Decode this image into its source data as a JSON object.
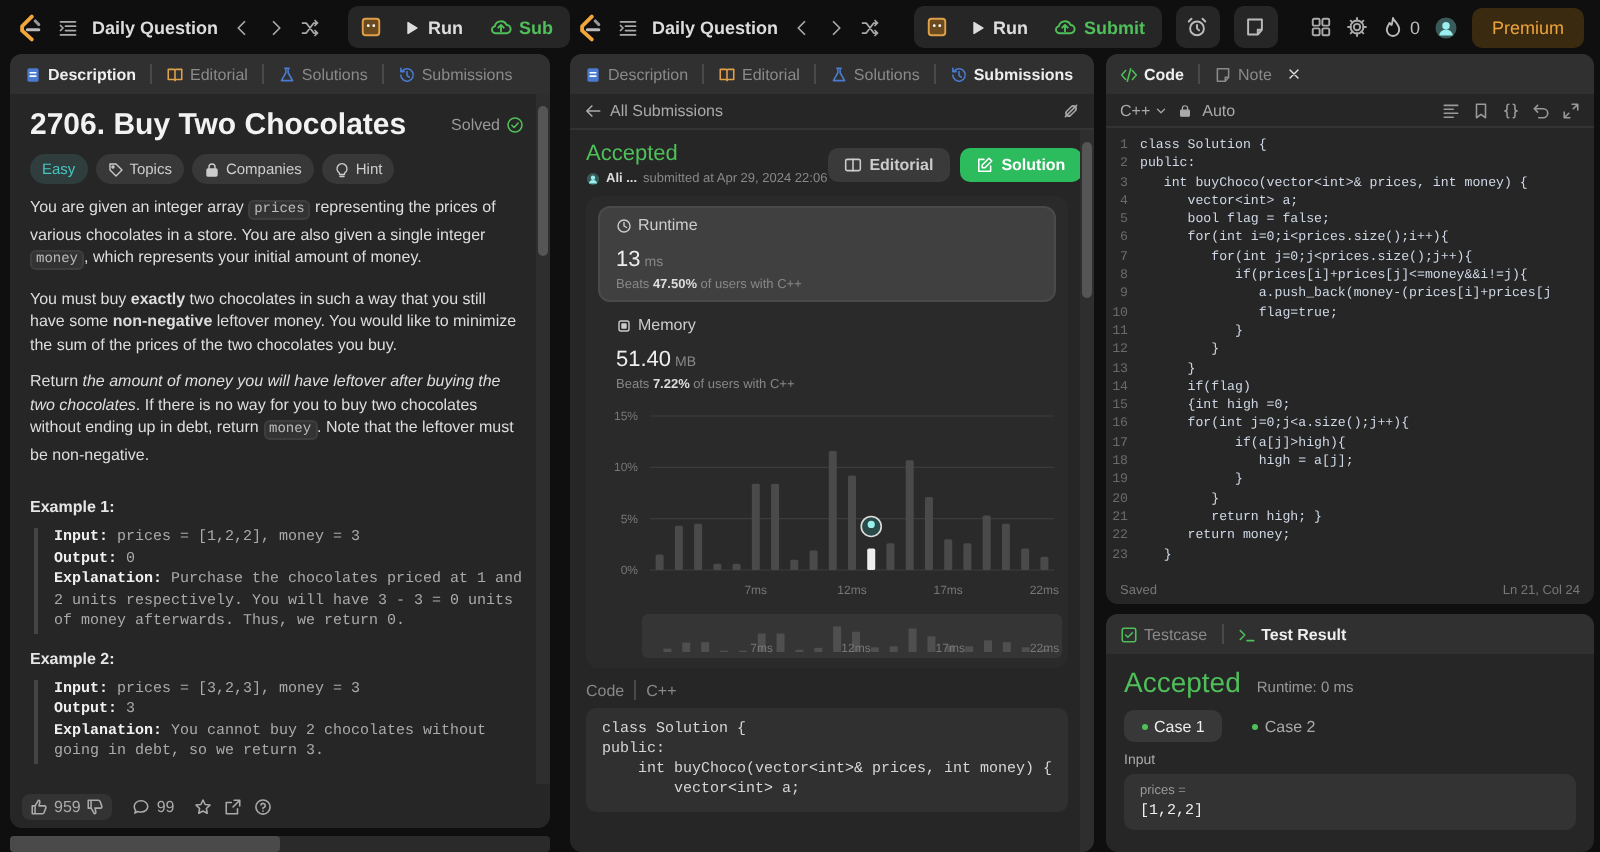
{
  "left": {
    "topbar": {
      "title": "Daily Question",
      "run": "Run",
      "submit": "Sub"
    },
    "tabs": [
      {
        "label": "Description",
        "kind": "description",
        "selected": true
      },
      {
        "label": "Editorial",
        "kind": "editorial",
        "selected": false
      },
      {
        "label": "Solutions",
        "kind": "solutions",
        "selected": false
      },
      {
        "label": "Submissions",
        "kind": "submissions",
        "selected": false
      }
    ],
    "problem": {
      "title": "2706. Buy Two Chocolates",
      "status": "Solved",
      "difficulty": "Easy",
      "tags": [
        {
          "label": "Topics",
          "kind": "tag"
        },
        {
          "label": "Companies",
          "kind": "lock"
        },
        {
          "label": "Hint",
          "kind": "bulb"
        }
      ],
      "paragraphs": [
        [
          {
            "kind": "text",
            "text": "You are given an integer array "
          },
          {
            "kind": "code",
            "text": "prices"
          },
          {
            "kind": "text",
            "text": " representing the prices of various chocolates in a store. You are also given a single integer "
          },
          {
            "kind": "code",
            "text": "money"
          },
          {
            "kind": "text",
            "text": ", which represents your initial amount of money."
          }
        ],
        [
          {
            "kind": "text",
            "text": "You must buy **exactly** two chocolates in such a way that you still have some **non-negative** leftover money. You would like to minimize the sum of the prices of the two chocolates you buy."
          }
        ],
        [
          {
            "kind": "text",
            "text": "Return *the amount of money you will have leftover after buying the two chocolates*. If there is no way for you to buy two chocolates without ending up in debt, return "
          },
          {
            "kind": "code",
            "text": "money"
          },
          {
            "kind": "text",
            "text": ". Note that the leftover must be non-negative."
          }
        ]
      ],
      "examples": [
        {
          "title": "Example 1:",
          "lines": [
            {
              "label": "Input:",
              "text": "prices = [1,2,2], money = 3"
            },
            {
              "label": "Output:",
              "text": "0"
            },
            {
              "label": "Explanation:",
              "text": "Purchase the chocolates priced at 1 and 2 units respectively. You will have 3 - 3 = 0 units of money afterwards. Thus, we return 0."
            }
          ]
        },
        {
          "title": "Example 2:",
          "lines": [
            {
              "label": "Input:",
              "text": "prices = [3,2,3], money = 3"
            },
            {
              "label": "Output:",
              "text": "3"
            },
            {
              "label": "Explanation:",
              "text": "You cannot buy 2 chocolates without going in debt, so we return 3."
            }
          ]
        }
      ]
    },
    "footer": {
      "likes": "959",
      "comments": "99"
    }
  },
  "right": {
    "topbar": {
      "title": "Daily Question",
      "run": "Run",
      "submit": "Submit",
      "streak": "0",
      "premium": "Premium"
    },
    "submission": {
      "tabs": [
        {
          "label": "Description",
          "kind": "description",
          "selected": false
        },
        {
          "label": "Editorial",
          "kind": "editorial",
          "selected": false
        },
        {
          "label": "Solutions",
          "kind": "solutions",
          "selected": false
        },
        {
          "label": "Submissions",
          "kind": "submissions",
          "selected": true
        }
      ],
      "back": "All Submissions",
      "status": "Accepted",
      "user": "Ali ...",
      "submitted": "submitted at Apr 29, 2024 22:06",
      "buttons": [
        {
          "label": "Editorial",
          "kind": "secondary"
        },
        {
          "label": "Solution",
          "kind": "primary"
        }
      ],
      "metrics": [
        {
          "title": "Runtime",
          "kind": "clock",
          "value": "13",
          "unit": "ms",
          "beats": "Beats **47.50%** of users with C++",
          "selected": true
        },
        {
          "title": "Memory",
          "kind": "chip",
          "value": "51.40",
          "unit": "MB",
          "beats": "Beats **7.22%** of users with C++",
          "selected": false
        }
      ],
      "chart_data": {
        "type": "bar",
        "x": [
          2,
          3,
          4,
          5,
          6,
          7,
          8,
          9,
          10,
          11,
          12,
          13,
          14,
          15,
          16,
          17,
          18,
          19,
          20,
          21,
          22
        ],
        "series": [
          {
            "color": "#4a4a4a",
            "values": [
              1.5,
              4.3,
              4.5,
              0.6,
              0.6,
              8.4,
              8.4,
              1.0,
              1.9,
              11.6,
              9.2,
              null,
              2.6,
              10.7,
              7.1,
              3.0,
              2.6,
              5.3,
              4.5,
              2.1,
              1.3
            ]
          },
          {
            "color": "#eeeeee",
            "values": [
              null,
              null,
              null,
              null,
              null,
              null,
              null,
              null,
              null,
              null,
              null,
              2.1,
              null,
              null,
              null,
              null,
              null,
              null,
              null,
              null,
              null
            ]
          }
        ],
        "xlim": [
          1.5,
          22.5
        ],
        "ylim": [
          0,
          15
        ],
        "yticks": [
          {
            "value": 0,
            "label": "0%"
          },
          {
            "value": 5,
            "label": "5%"
          },
          {
            "value": 10,
            "label": "10%"
          },
          {
            "value": 15,
            "label": "15%"
          }
        ],
        "xticks": [
          {
            "value": 7,
            "label": "7ms"
          },
          {
            "value": 12,
            "label": "12ms"
          },
          {
            "value": 17,
            "label": "17ms"
          },
          {
            "value": 22,
            "label": "22ms"
          }
        ]
      },
      "range_labels": [
        "7ms",
        "12ms",
        "17ms",
        "22ms"
      ],
      "code_label": "Code",
      "code_language": "C++",
      "code": [
        "class Solution {",
        "public:",
        "    int buyChoco(vector<int>& prices, int money) {",
        "        vector<int> a;"
      ]
    },
    "editor": {
      "tabs": [
        {
          "label": "Code",
          "kind": "code",
          "selected": true
        },
        {
          "label": "Note",
          "kind": "note",
          "selected": false
        }
      ],
      "language": "C++",
      "mode": "Auto",
      "lines": [
        {
          "n": "1",
          "code": "class Solution {"
        },
        {
          "n": "2",
          "code": "public:"
        },
        {
          "n": "3",
          "code": "   int buyChoco(vector<int>& prices, int money) {"
        },
        {
          "n": "4",
          "code": "      vector<int> a;"
        },
        {
          "n": "5",
          "code": "      bool flag = false;"
        },
        {
          "n": "6",
          "code": "      for(int i=0;i<prices.size();i++){"
        },
        {
          "n": "7",
          "code": "         for(int j=0;j<prices.size();j++){"
        },
        {
          "n": "8",
          "code": "            if(prices[i]+prices[j]<=money&&i!=j){"
        },
        {
          "n": "9",
          "code": "               a.push_back(money-(prices[i]+prices[j"
        },
        {
          "n": "10",
          "code": "               flag=true;"
        },
        {
          "n": "11",
          "code": "            }"
        },
        {
          "n": "12",
          "code": "         }"
        },
        {
          "n": "13",
          "code": "      }"
        },
        {
          "n": "14",
          "code": "      if(flag)"
        },
        {
          "n": "15",
          "code": "      {int high =0;"
        },
        {
          "n": "16",
          "code": "      for(int j=0;j<a.size();j++){"
        },
        {
          "n": "17",
          "code": "            if(a[j]>high){"
        },
        {
          "n": "18",
          "code": "               high = a[j];"
        },
        {
          "n": "19",
          "code": "            }"
        },
        {
          "n": "20",
          "code": "         }"
        },
        {
          "n": "21",
          "code": "         return high; }"
        },
        {
          "n": "22",
          "code": "      return money;"
        },
        {
          "n": "23",
          "code": "   }"
        }
      ],
      "status": "Saved",
      "position": "Ln 21, Col 24"
    },
    "result": {
      "tabs": [
        {
          "label": "Testcase",
          "kind": "testcase",
          "selected": false
        },
        {
          "label": "Test Result",
          "kind": "terminal",
          "selected": true
        }
      ],
      "status": "Accepted",
      "runtime": "Runtime: 0 ms",
      "cases": [
        {
          "label": "Case 1",
          "selected": true
        },
        {
          "label": "Case 2",
          "selected": false
        }
      ],
      "input_label": "Input",
      "inputs": [
        {
          "name": "prices =",
          "value": "[1,2,2]"
        }
      ]
    }
  }
}
